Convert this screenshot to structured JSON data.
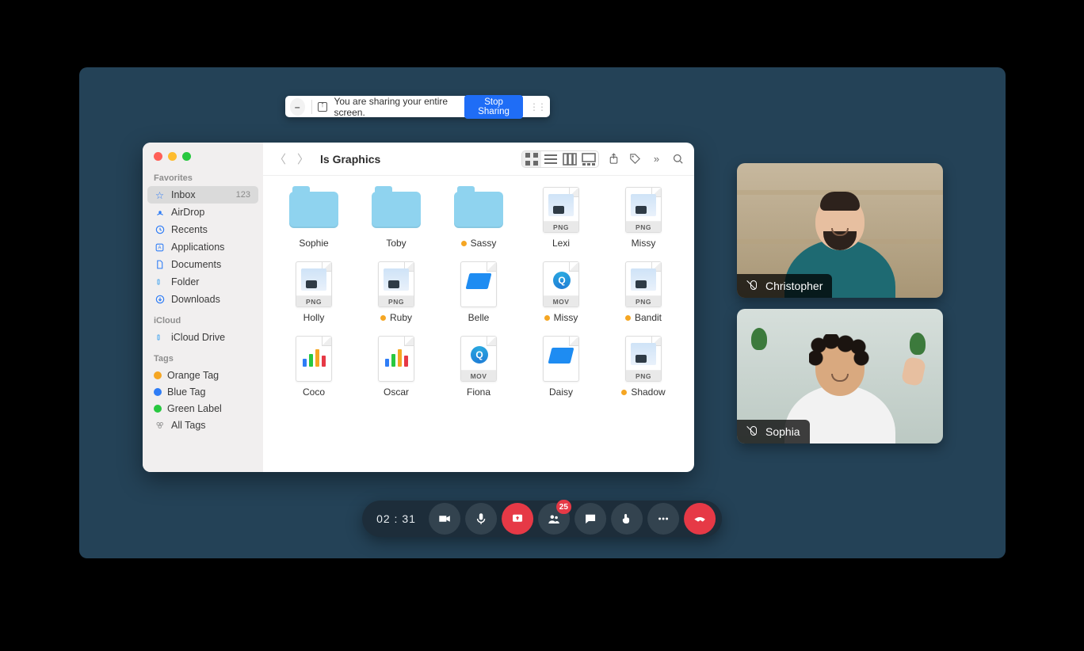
{
  "share_bar": {
    "text": "You are sharing your entire screen.",
    "stop": "Stop Sharing"
  },
  "finder": {
    "title": "ls Graphics",
    "sidebar": {
      "favorites_header": "Favorites",
      "items": [
        {
          "label": "Inbox",
          "count": "123"
        },
        {
          "label": "AirDrop"
        },
        {
          "label": "Recents"
        },
        {
          "label": "Applications"
        },
        {
          "label": "Documents"
        },
        {
          "label": "Folder"
        },
        {
          "label": "Downloads"
        }
      ],
      "icloud_header": "iCloud",
      "icloud_item": "iCloud Drive",
      "tags_header": "Tags",
      "tags": [
        {
          "label": "Orange Tag",
          "color": "#f5a623"
        },
        {
          "label": "Blue Tag",
          "color": "#2f7df6"
        },
        {
          "label": "Green Label",
          "color": "#28c840"
        }
      ],
      "all_tags": "All Tags"
    },
    "files": [
      {
        "name": "Sophie",
        "kind": "folder",
        "tagged": false
      },
      {
        "name": "Toby",
        "kind": "folder",
        "tagged": false
      },
      {
        "name": "Sassy",
        "kind": "folder",
        "tagged": true
      },
      {
        "name": "Lexi",
        "kind": "png",
        "tagged": false
      },
      {
        "name": "Missy",
        "kind": "png",
        "tagged": false
      },
      {
        "name": "Holly",
        "kind": "png",
        "tagged": false
      },
      {
        "name": "Ruby",
        "kind": "png",
        "tagged": true
      },
      {
        "name": "Belle",
        "kind": "key",
        "tagged": false
      },
      {
        "name": "Missy",
        "kind": "mov",
        "tagged": true
      },
      {
        "name": "Bandit",
        "kind": "png",
        "tagged": true
      },
      {
        "name": "Coco",
        "kind": "chart",
        "tagged": false
      },
      {
        "name": "Oscar",
        "kind": "chart",
        "tagged": false
      },
      {
        "name": "Fiona",
        "kind": "mov",
        "tagged": false
      },
      {
        "name": "Daisy",
        "kind": "key",
        "tagged": false
      },
      {
        "name": "Shadow",
        "kind": "png",
        "tagged": true
      }
    ],
    "badges": {
      "png": "PNG",
      "mov": "MOV"
    }
  },
  "participants": [
    {
      "name": "Christopher"
    },
    {
      "name": "Sophia"
    }
  ],
  "dock": {
    "time": "02 : 31",
    "participants_badge": "25"
  }
}
